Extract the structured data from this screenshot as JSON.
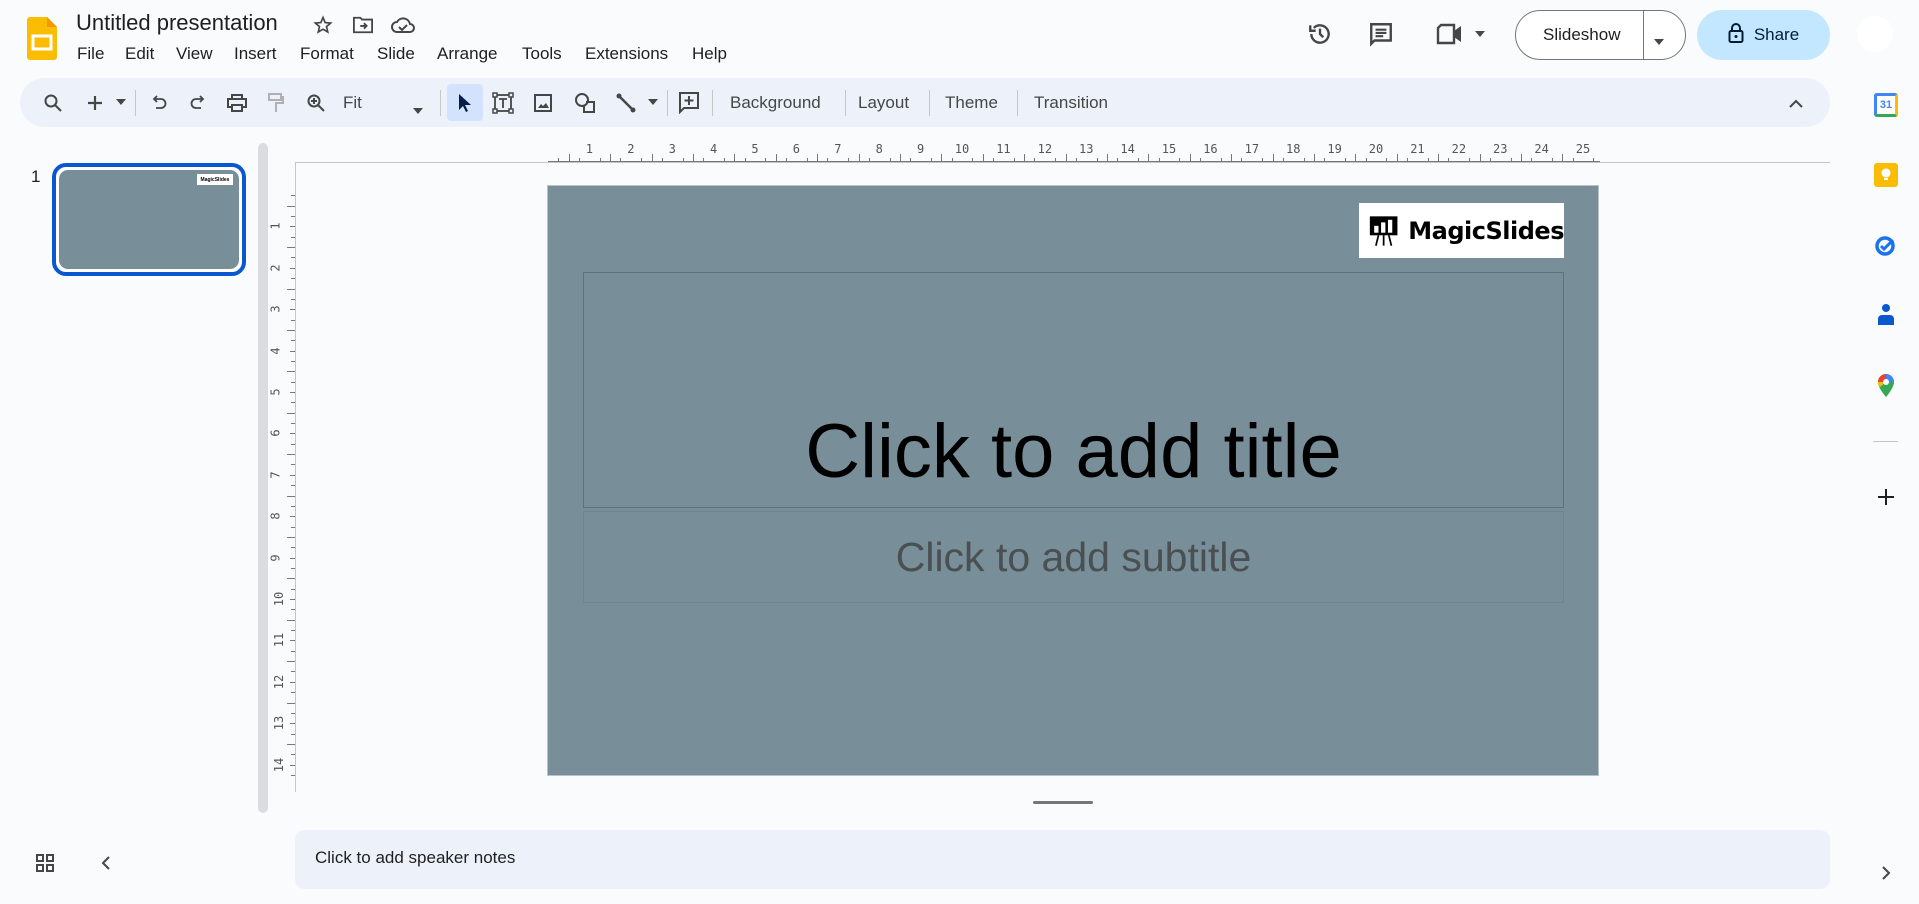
{
  "app": {
    "title": "Untitled presentation",
    "icons": [
      "star-icon",
      "move-folder-icon",
      "cloud-saved-icon"
    ]
  },
  "menu": [
    "File",
    "Edit",
    "View",
    "Insert",
    "Format",
    "Slide",
    "Arrange",
    "Tools",
    "Extensions",
    "Help"
  ],
  "header": {
    "slideshow_label": "Slideshow",
    "share_label": "Share"
  },
  "toolbar": {
    "zoom_value": "Fit",
    "background": "Background",
    "layout": "Layout",
    "theme": "Theme",
    "transition": "Transition"
  },
  "filmstrip": {
    "slide_number": "1",
    "thumb_logo": "MagicSlides"
  },
  "ruler": {
    "horizontal": [
      "1",
      "2",
      "3",
      "4",
      "5",
      "6",
      "7",
      "8",
      "9",
      "10",
      "11",
      "12",
      "13",
      "14",
      "15",
      "16",
      "17",
      "18",
      "19",
      "20",
      "21",
      "22",
      "23",
      "24",
      "25"
    ],
    "vertical": [
      "1",
      "2",
      "3",
      "4",
      "5",
      "6",
      "7",
      "8",
      "9",
      "10",
      "11",
      "12",
      "13",
      "14"
    ]
  },
  "slide": {
    "logo_text": "MagicSlides",
    "title_placeholder": "Click to add title",
    "subtitle_placeholder": "Click to add subtitle",
    "background": "#788e99"
  },
  "notes": {
    "placeholder": "Click to add speaker notes"
  },
  "colors": {
    "accent": "#0b57d0",
    "share_bg": "#c2e7ff",
    "toolbar_bg": "#edf2fa"
  }
}
